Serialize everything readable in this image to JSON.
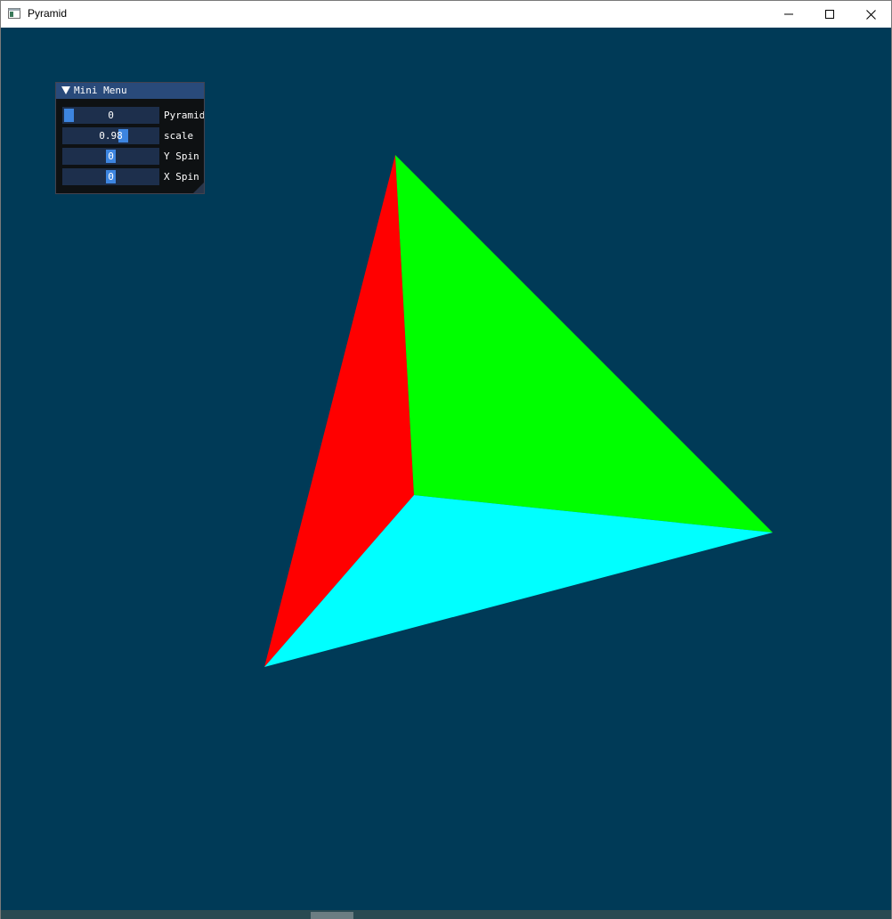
{
  "window": {
    "title": "Pyramid",
    "icons": {
      "app": "app-window-icon",
      "minimize": "minimize-icon",
      "maximize": "maximize-icon",
      "close": "close-icon"
    }
  },
  "colors": {
    "background": "#003a57",
    "face_left": "#ff0000",
    "face_right": "#00ff00",
    "face_bottom": "#00ffff",
    "slider_grab": "#3d85e0",
    "menu_header": "#294a7a"
  },
  "menu": {
    "title": "Mini Menu",
    "collapse_icon": "collapse-triangle-icon",
    "sliders": [
      {
        "label": "Pyramid",
        "value": "0",
        "level": 0.0
      },
      {
        "label": "scale",
        "value": "0.98",
        "level": 0.65
      },
      {
        "label": "Y Spin",
        "value": "0",
        "level": 0.5
      },
      {
        "label": "X Spin",
        "value": "0",
        "level": 0.5
      }
    ]
  }
}
